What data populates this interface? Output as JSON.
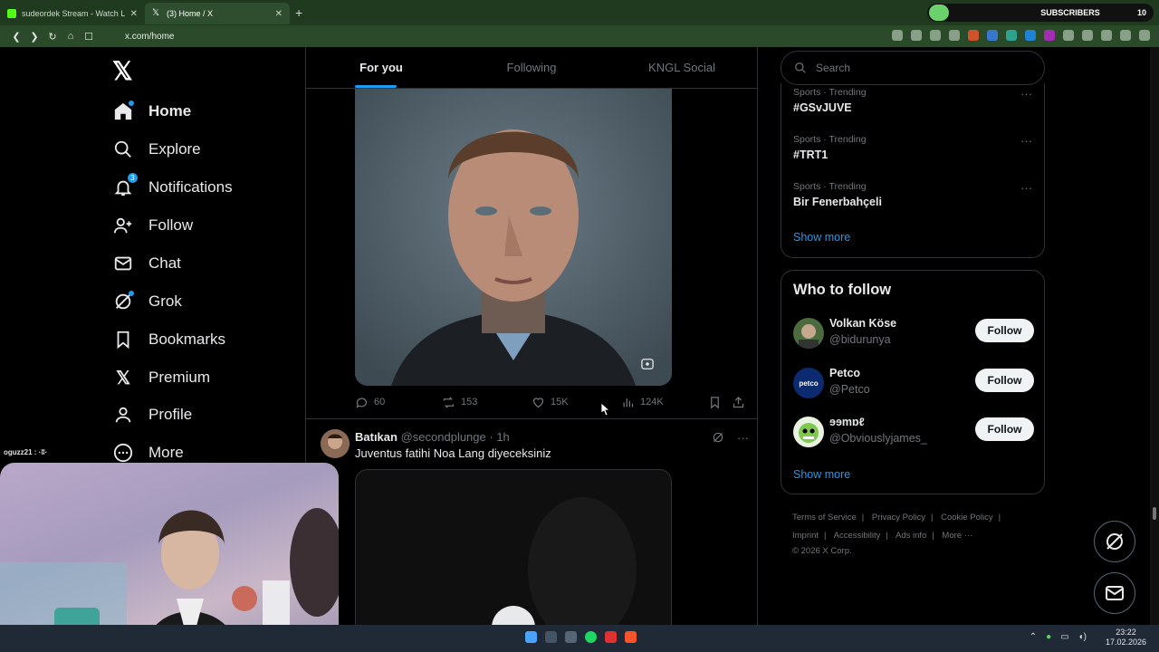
{
  "browser": {
    "tabs": [
      {
        "title": "sudeordek Stream - Watch Live o",
        "favicon_color": "#53fc18",
        "active": false
      },
      {
        "title": "(3) Home / X",
        "favicon_color": "#ffffff",
        "active": true
      }
    ],
    "new_tab_icon": "plus-icon",
    "url": "x.com/home",
    "subscribers_label": "SUBSCRIBERS",
    "subscribers_count": "10"
  },
  "sidebar": {
    "logo": "𝕏",
    "items": [
      {
        "label": "Home",
        "icon": "home-icon",
        "active": true
      },
      {
        "label": "Explore",
        "icon": "search-icon"
      },
      {
        "label": "Notifications",
        "icon": "bell-icon",
        "badge": "3"
      },
      {
        "label": "Follow",
        "icon": "add-person-icon"
      },
      {
        "label": "Chat",
        "icon": "mail-icon"
      },
      {
        "label": "Grok",
        "icon": "grok-icon"
      },
      {
        "label": "Bookmarks",
        "icon": "bookmark-icon"
      },
      {
        "label": "Premium",
        "icon": "x-logo-icon"
      },
      {
        "label": "Profile",
        "icon": "person-icon"
      },
      {
        "label": "More",
        "icon": "more-circle-icon"
      }
    ]
  },
  "feed": {
    "tabs": [
      "For you",
      "Following",
      "KNGL Social"
    ],
    "post1": {
      "replies": "60",
      "reposts": "153",
      "likes": "15K",
      "views": "124K"
    },
    "post2": {
      "name": "Batıkan",
      "handle": "@secondplunge",
      "time": "· 1h",
      "text": "Juventus fatihi Noa Lang diyeceksiniz"
    }
  },
  "right": {
    "search_placeholder": "Search",
    "trends": [
      {
        "meta": "Sports · Trending",
        "title": "#GSvJUVE"
      },
      {
        "meta": "Sports · Trending",
        "title": "#TRT1"
      },
      {
        "meta": "Sports · Trending",
        "title": "Bir Fenerbahçeli"
      }
    ],
    "trends_show_more": "Show more",
    "who_to_follow": {
      "title": "Who to follow",
      "users": [
        {
          "name": "Volkan Köse",
          "handle": "@bidurunya",
          "button": "Follow"
        },
        {
          "name": "Petco",
          "handle": "@Petco",
          "button": "Follow",
          "avatar_text": "petco"
        },
        {
          "name": "ɘɘmɒℓ",
          "handle": "@Obviouslyjames_",
          "button": "Follow"
        }
      ],
      "show_more": "Show more"
    },
    "footer": {
      "links": [
        "Terms of Service",
        "Privacy Policy",
        "Cookie Policy",
        "Imprint",
        "Accessibility",
        "Ads info",
        "More ···"
      ],
      "copyright": "© 2026 X Corp."
    }
  },
  "overlay": {
    "chat_user": "oguzz21 : ·ʬ·"
  },
  "taskbar": {
    "time": "23:22",
    "date": "17.02.2026"
  }
}
